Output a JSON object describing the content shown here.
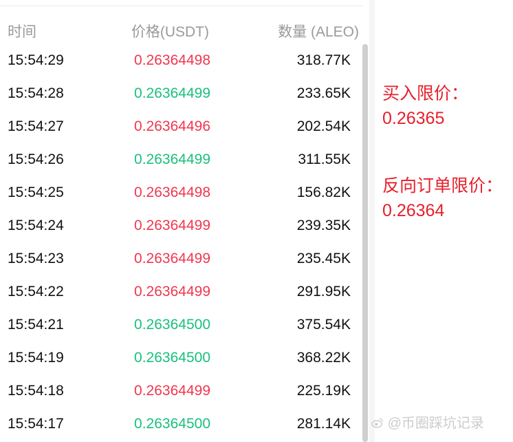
{
  "trades": {
    "headers": {
      "time": "时间",
      "price": "价格(USDT)",
      "quantity": "数量 (ALEO)"
    },
    "rows": [
      {
        "time": "15:54:29",
        "price": "0.26364498",
        "quantity": "318.77K",
        "side": "sell"
      },
      {
        "time": "15:54:28",
        "price": "0.26364499",
        "quantity": "233.65K",
        "side": "buy"
      },
      {
        "time": "15:54:27",
        "price": "0.26364496",
        "quantity": "202.54K",
        "side": "sell"
      },
      {
        "time": "15:54:26",
        "price": "0.26364499",
        "quantity": "311.55K",
        "side": "buy"
      },
      {
        "time": "15:54:25",
        "price": "0.26364498",
        "quantity": "156.82K",
        "side": "sell"
      },
      {
        "time": "15:54:24",
        "price": "0.26364499",
        "quantity": "239.35K",
        "side": "sell"
      },
      {
        "time": "15:54:23",
        "price": "0.26364499",
        "quantity": "235.45K",
        "side": "sell"
      },
      {
        "time": "15:54:22",
        "price": "0.26364499",
        "quantity": "291.95K",
        "side": "sell"
      },
      {
        "time": "15:54:21",
        "price": "0.26364500",
        "quantity": "375.54K",
        "side": "buy"
      },
      {
        "time": "15:54:19",
        "price": "0.26364500",
        "quantity": "368.22K",
        "side": "buy"
      },
      {
        "time": "15:54:18",
        "price": "0.26364499",
        "quantity": "225.19K",
        "side": "sell"
      },
      {
        "time": "15:54:17",
        "price": "0.26364500",
        "quantity": "281.14K",
        "side": "buy"
      }
    ]
  },
  "annotations": {
    "buy_limit_label": "买入限价：",
    "buy_limit_value": "0.26365",
    "reverse_limit_label": "反向订单限价：",
    "reverse_limit_value": "0.26364"
  },
  "watermark": {
    "text": "@币圈踩坑记录",
    "icon": "weibo-icon"
  },
  "colors": {
    "buy": "#19c07d",
    "sell": "#f0364f",
    "annotation": "#e6202b"
  }
}
